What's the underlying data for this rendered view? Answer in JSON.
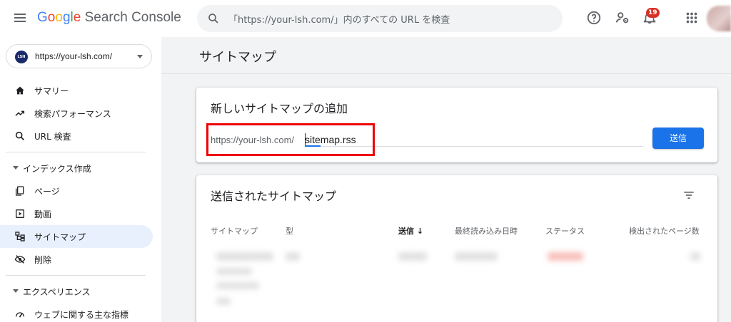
{
  "header": {
    "brand_letters": [
      "G",
      "o",
      "o",
      "g",
      "l",
      "e"
    ],
    "product_name": "Search Console",
    "search_placeholder": "「https://your-lsh.com/」内のすべての URL を検査",
    "notification_count": "19"
  },
  "sidebar": {
    "property_url": "https://your-lsh.com/",
    "property_logo_text": "LSH",
    "items": [
      {
        "label": "サマリー",
        "icon": "home-icon"
      },
      {
        "label": "検索パフォーマンス",
        "icon": "trending-up-icon"
      },
      {
        "label": "URL 検査",
        "icon": "search-icon"
      }
    ],
    "index_section": {
      "label": "インデックス作成",
      "items": [
        {
          "label": "ページ",
          "icon": "pages-icon"
        },
        {
          "label": "動画",
          "icon": "video-icon"
        },
        {
          "label": "サイトマップ",
          "icon": "sitemap-icon",
          "active": true
        },
        {
          "label": "削除",
          "icon": "removal-icon"
        }
      ]
    },
    "experience_section": {
      "label": "エクスペリエンス",
      "items": [
        {
          "label": "ウェブに関する主な指標",
          "icon": "speed-icon"
        }
      ]
    }
  },
  "main": {
    "page_title": "サイトマップ",
    "add_card": {
      "title": "新しいサイトマップの追加",
      "url_prefix": "https://your-lsh.com/",
      "input_value": "sitemap.rss",
      "submit_label": "送信"
    },
    "submitted_card": {
      "title": "送信されたサイトマップ",
      "columns": [
        "サイトマップ",
        "型",
        "送信",
        "最終読み込み日時",
        "ステータス",
        "検出されたページ数"
      ],
      "sorted_column": "送信"
    }
  },
  "colors": {
    "accent": "#1a73e8",
    "active_nav": "#e8f0fe",
    "highlight_box": "#ee0000",
    "badge": "#d93025"
  }
}
